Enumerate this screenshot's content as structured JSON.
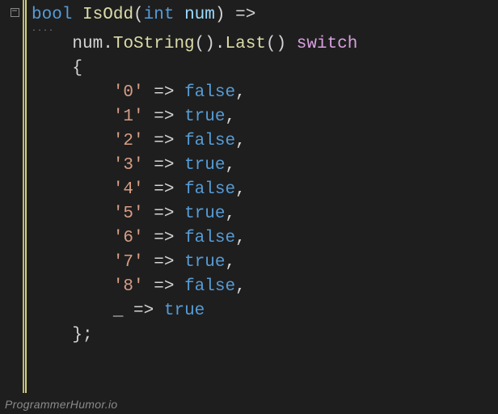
{
  "code": {
    "sig": {
      "ret": "bool",
      "name": "IsOdd",
      "ptype": "int",
      "pname": "num",
      "arrow": "=>"
    },
    "expr": {
      "obj": "num",
      "m1": "ToString",
      "m2": "Last",
      "switchkw": "switch"
    },
    "open_brace": "{",
    "close_brace": "};",
    "arms": [
      {
        "pattern": "'0'",
        "arrow": "=>",
        "result": "false",
        "comma": ","
      },
      {
        "pattern": "'1'",
        "arrow": "=>",
        "result": "true",
        "comma": ","
      },
      {
        "pattern": "'2'",
        "arrow": "=>",
        "result": "false",
        "comma": ","
      },
      {
        "pattern": "'3'",
        "arrow": "=>",
        "result": "true",
        "comma": ","
      },
      {
        "pattern": "'4'",
        "arrow": "=>",
        "result": "false",
        "comma": ","
      },
      {
        "pattern": "'5'",
        "arrow": "=>",
        "result": "true",
        "comma": ","
      },
      {
        "pattern": "'6'",
        "arrow": "=>",
        "result": "false",
        "comma": ","
      },
      {
        "pattern": "'7'",
        "arrow": "=>",
        "result": "true",
        "comma": ","
      },
      {
        "pattern": "'8'",
        "arrow": "=>",
        "result": "false",
        "comma": ","
      },
      {
        "pattern": "_",
        "arrow": "=>",
        "result": "true",
        "comma": ""
      }
    ]
  },
  "dots": "....",
  "watermark": "ProgrammerHumor.io",
  "fold_glyph": "−"
}
